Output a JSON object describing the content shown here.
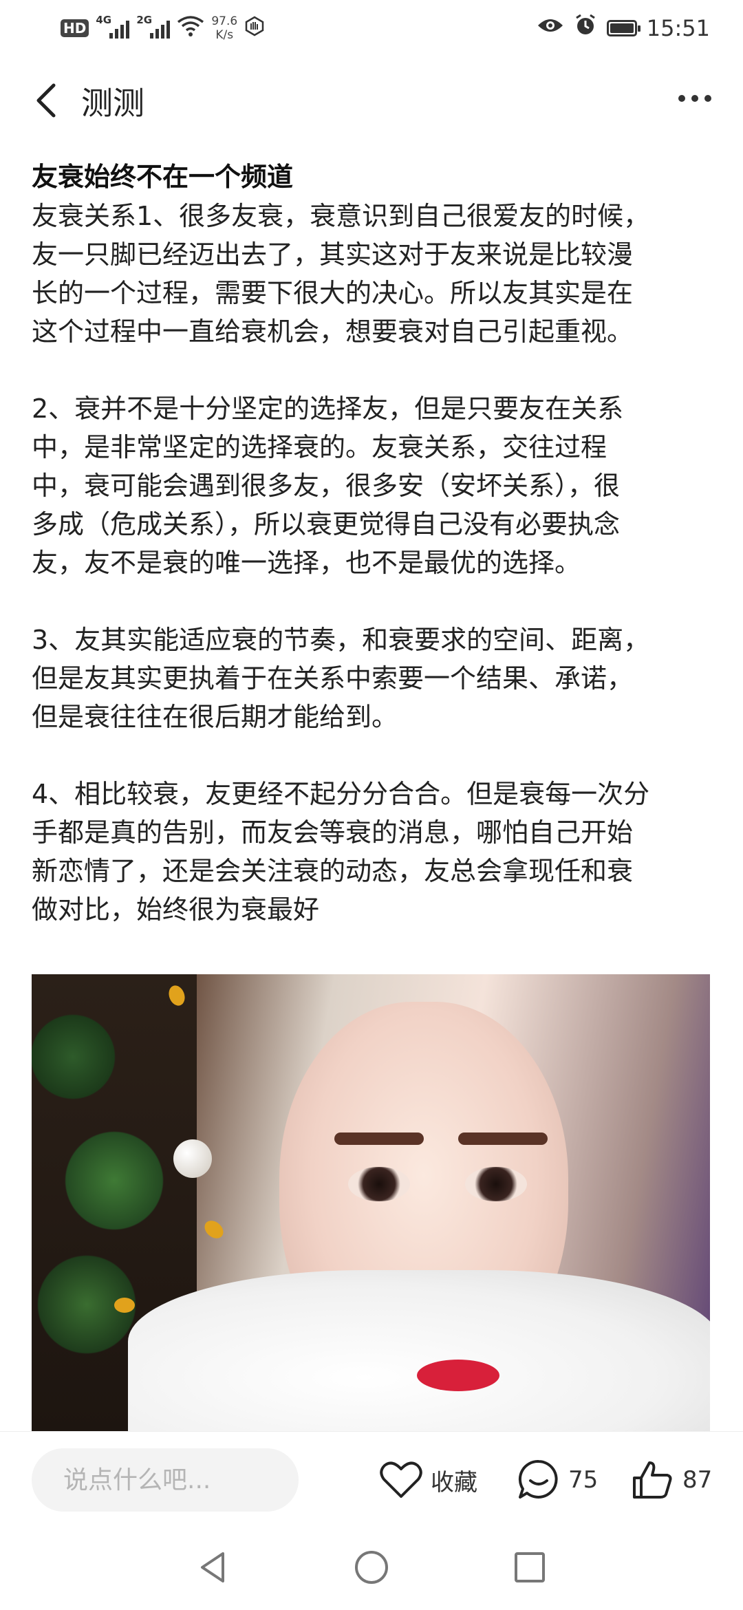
{
  "status_bar": {
    "hd": "HD",
    "net1": "4G",
    "net2": "2G",
    "speed_value": "97.6",
    "speed_unit": "K/s",
    "time": "15:51",
    "icons": [
      "hd-icon",
      "signal-icon",
      "signal-icon",
      "wifi-icon",
      "hand-icon",
      "eye-icon",
      "alarm-icon",
      "battery-icon"
    ]
  },
  "header": {
    "title": "测测",
    "back_icon": "back-arrow-icon",
    "more_icon": "more-icon"
  },
  "article": {
    "title": "友衰始终不在一个频道",
    "paragraphs": [
      "友衰关系1、很多友衰，衰意识到自己很爱友的时候，\n友一只脚已经迈出去了，其实这对于友来说是比较漫\n长的一个过程，需要下很大的决心。所以友其实是在\n这个过程中一直给衰机会，想要衰对自己引起重视。",
      "2、衰并不是十分坚定的选择友，但是只要友在关系\n中，是非常坚定的选择衰的。友衰关系，交往过程\n中，衰可能会遇到很多友，很多安（安坏关系），很\n多成（危成关系），所以衰更觉得自己没有必要执念\n友，友不是衰的唯一选择，也不是最优的选择。",
      "3、友其实能适应衰的节奏，和衰要求的空间、距离，\n但是友其实更执着于在关系中索要一个结果、承诺，\n但是衰往往在很后期才能给到。",
      "4、相比较衰，友更经不起分分合合。但是衰每一次分\n手都是真的告别，而友会等衰的消息，哪怕自己开始\n新恋情了，还是会关注衰的动态，友总会拿现任和衰\n做对比，始终很为衰最好"
    ]
  },
  "bottom_bar": {
    "comment_placeholder": "说点什么吧...",
    "favorite_label": "收藏",
    "comment_count": "75",
    "like_count": "87"
  }
}
